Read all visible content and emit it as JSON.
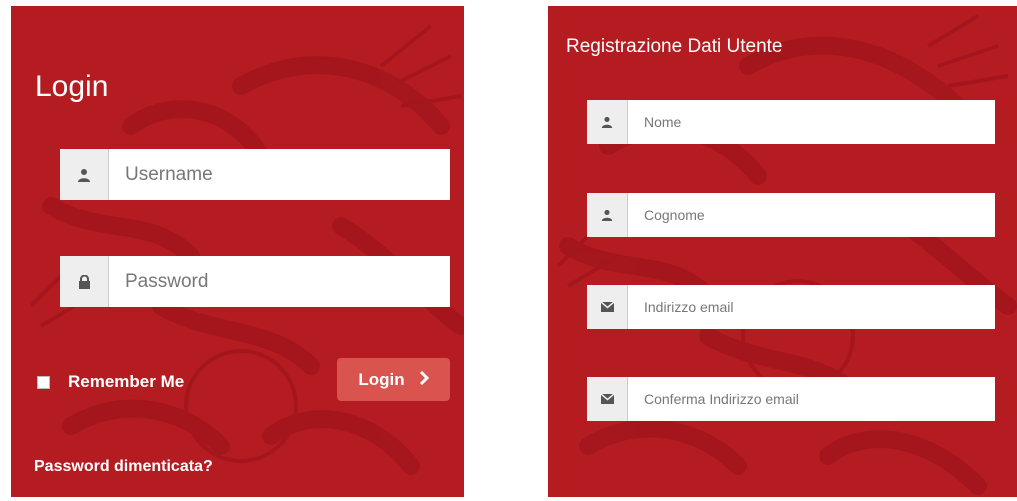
{
  "login": {
    "title": "Login",
    "username_placeholder": "Username",
    "password_placeholder": "Password",
    "remember_label": "Remember Me",
    "login_button_label": "Login",
    "forgot_password_link": "Password dimenticata?"
  },
  "registration": {
    "title": "Registrazione Dati Utente",
    "nome_placeholder": "Nome",
    "cognome_placeholder": "Cognome",
    "email_placeholder": "Indirizzo email",
    "confirm_email_placeholder": "Conferma Indirizzo email"
  },
  "icons": {
    "user": "user-icon",
    "lock": "lock-icon",
    "envelope": "envelope-icon",
    "chevron": "chevron-right-icon"
  },
  "colors": {
    "panel_background": "#b51c22",
    "button_background": "#d9534f",
    "addon_background": "#eeeeee"
  }
}
